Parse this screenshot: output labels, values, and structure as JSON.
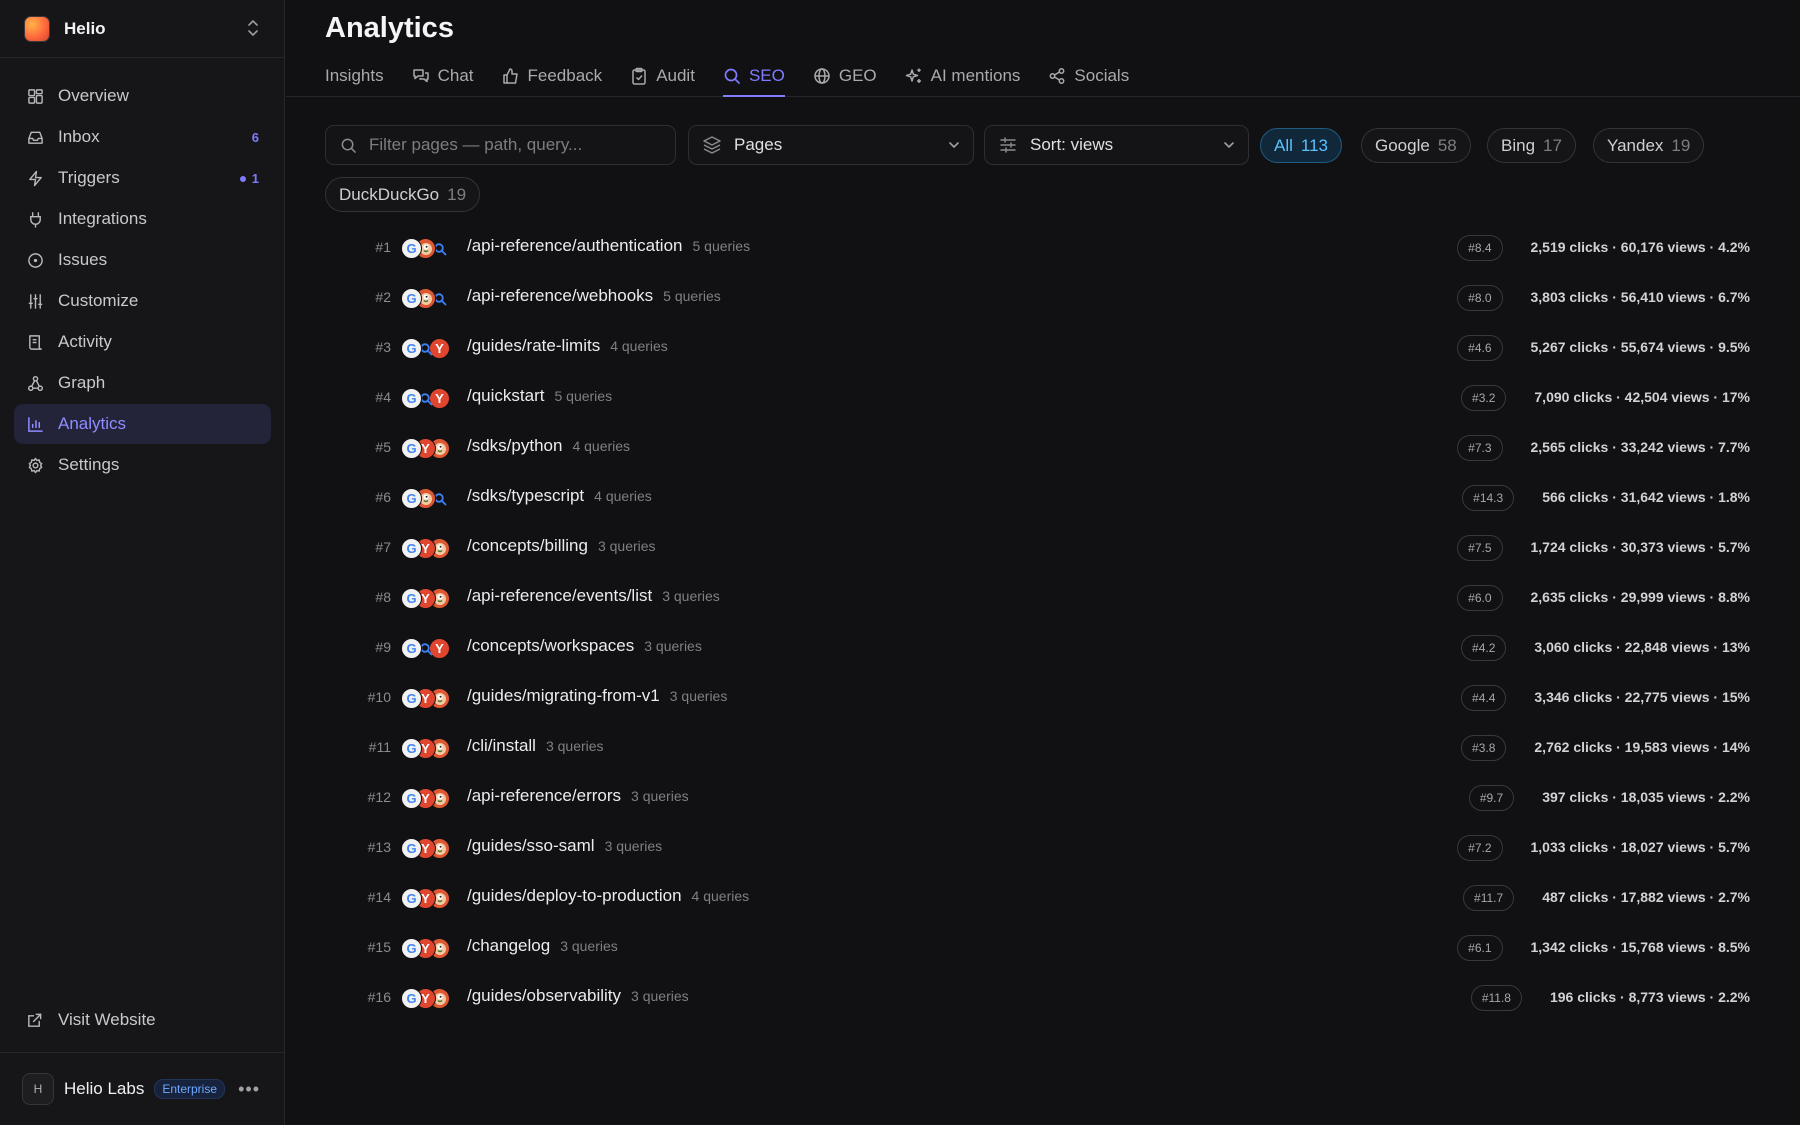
{
  "app": {
    "name": "Helio"
  },
  "sidebar": {
    "items": [
      {
        "label": "Overview",
        "icon": "grid-icon"
      },
      {
        "label": "Inbox",
        "icon": "inbox-icon",
        "badge": "6"
      },
      {
        "label": "Triggers",
        "icon": "bolt-icon",
        "badge": "1"
      },
      {
        "label": "Integrations",
        "icon": "plug-icon"
      },
      {
        "label": "Issues",
        "icon": "alert-circle-icon"
      },
      {
        "label": "Customize",
        "icon": "sliders-icon"
      },
      {
        "label": "Activity",
        "icon": "receipt-icon"
      },
      {
        "label": "Graph",
        "icon": "graph-icon"
      },
      {
        "label": "Analytics",
        "icon": "bar-chart-icon",
        "active": true
      },
      {
        "label": "Settings",
        "icon": "gear-icon"
      }
    ],
    "visit_label": "Visit Website",
    "org": {
      "initial": "H",
      "name": "Helio Labs",
      "plan": "Enterprise"
    }
  },
  "header": {
    "title": "Analytics",
    "tabs": [
      {
        "label": "Insights"
      },
      {
        "label": "Chat"
      },
      {
        "label": "Feedback"
      },
      {
        "label": "Audit"
      },
      {
        "label": "SEO",
        "active": true
      },
      {
        "label": "GEO"
      },
      {
        "label": "AI mentions"
      },
      {
        "label": "Socials"
      }
    ]
  },
  "filters": {
    "search_placeholder": "Filter pages — path, query...",
    "view_select": "Pages",
    "sort_select": "Sort: views",
    "chips": [
      {
        "label": "All",
        "count": "113",
        "active": true
      },
      {
        "label": "Google",
        "count": "58"
      },
      {
        "label": "Bing",
        "count": "17"
      },
      {
        "label": "Yandex",
        "count": "19"
      },
      {
        "label": "DuckDuckGo",
        "count": "19"
      }
    ]
  },
  "colors": {
    "accent": "#7f7cff",
    "chip_active": "#5cc1ff",
    "background": "#111113"
  },
  "pages": [
    {
      "rank": "#1",
      "engines": [
        "google",
        "duckduckgo",
        "bing"
      ],
      "path": "/api-reference/authentication",
      "queries": "5 queries",
      "position": "#8.4",
      "stats": "2,519 clicks · 60,176 views · 4.2%"
    },
    {
      "rank": "#2",
      "engines": [
        "google",
        "duckduckgo",
        "bing"
      ],
      "path": "/api-reference/webhooks",
      "queries": "5 queries",
      "position": "#8.0",
      "stats": "3,803 clicks · 56,410 views · 6.7%"
    },
    {
      "rank": "#3",
      "engines": [
        "google",
        "bing",
        "yandex"
      ],
      "path": "/guides/rate-limits",
      "queries": "4 queries",
      "position": "#4.6",
      "stats": "5,267 clicks · 55,674 views · 9.5%"
    },
    {
      "rank": "#4",
      "engines": [
        "google",
        "bing",
        "yandex"
      ],
      "path": "/quickstart",
      "queries": "5 queries",
      "position": "#3.2",
      "stats": "7,090 clicks · 42,504 views · 17%"
    },
    {
      "rank": "#5",
      "engines": [
        "google",
        "yandex",
        "duckduckgo"
      ],
      "path": "/sdks/python",
      "queries": "4 queries",
      "position": "#7.3",
      "stats": "2,565 clicks · 33,242 views · 7.7%"
    },
    {
      "rank": "#6",
      "engines": [
        "google",
        "duckduckgo",
        "bing"
      ],
      "path": "/sdks/typescript",
      "queries": "4 queries",
      "position": "#14.3",
      "stats": "566 clicks · 31,642 views · 1.8%"
    },
    {
      "rank": "#7",
      "engines": [
        "google",
        "yandex",
        "duckduckgo"
      ],
      "path": "/concepts/billing",
      "queries": "3 queries",
      "position": "#7.5",
      "stats": "1,724 clicks · 30,373 views · 5.7%"
    },
    {
      "rank": "#8",
      "engines": [
        "google",
        "yandex",
        "duckduckgo"
      ],
      "path": "/api-reference/events/list",
      "queries": "3 queries",
      "position": "#6.0",
      "stats": "2,635 clicks · 29,999 views · 8.8%"
    },
    {
      "rank": "#9",
      "engines": [
        "google",
        "bing",
        "yandex"
      ],
      "path": "/concepts/workspaces",
      "queries": "3 queries",
      "position": "#4.2",
      "stats": "3,060 clicks · 22,848 views · 13%"
    },
    {
      "rank": "#10",
      "engines": [
        "google",
        "yandex",
        "duckduckgo"
      ],
      "path": "/guides/migrating-from-v1",
      "queries": "3 queries",
      "position": "#4.4",
      "stats": "3,346 clicks · 22,775 views · 15%"
    },
    {
      "rank": "#11",
      "engines": [
        "google",
        "yandex",
        "duckduckgo"
      ],
      "path": "/cli/install",
      "queries": "3 queries",
      "position": "#3.8",
      "stats": "2,762 clicks · 19,583 views · 14%"
    },
    {
      "rank": "#12",
      "engines": [
        "google",
        "yandex",
        "duckduckgo"
      ],
      "path": "/api-reference/errors",
      "queries": "3 queries",
      "position": "#9.7",
      "stats": "397 clicks · 18,035 views · 2.2%"
    },
    {
      "rank": "#13",
      "engines": [
        "google",
        "yandex",
        "duckduckgo"
      ],
      "path": "/guides/sso-saml",
      "queries": "3 queries",
      "position": "#7.2",
      "stats": "1,033 clicks · 18,027 views · 5.7%"
    },
    {
      "rank": "#14",
      "engines": [
        "google",
        "yandex",
        "duckduckgo"
      ],
      "path": "/guides/deploy-to-production",
      "queries": "4 queries",
      "position": "#11.7",
      "stats": "487 clicks · 17,882 views · 2.7%"
    },
    {
      "rank": "#15",
      "engines": [
        "google",
        "yandex",
        "duckduckgo"
      ],
      "path": "/changelog",
      "queries": "3 queries",
      "position": "#6.1",
      "stats": "1,342 clicks · 15,768 views · 8.5%"
    },
    {
      "rank": "#16",
      "engines": [
        "google",
        "yandex",
        "duckduckgo"
      ],
      "path": "/guides/observability",
      "queries": "3 queries",
      "position": "#11.8",
      "stats": "196 clicks · 8,773 views · 2.2%"
    }
  ]
}
